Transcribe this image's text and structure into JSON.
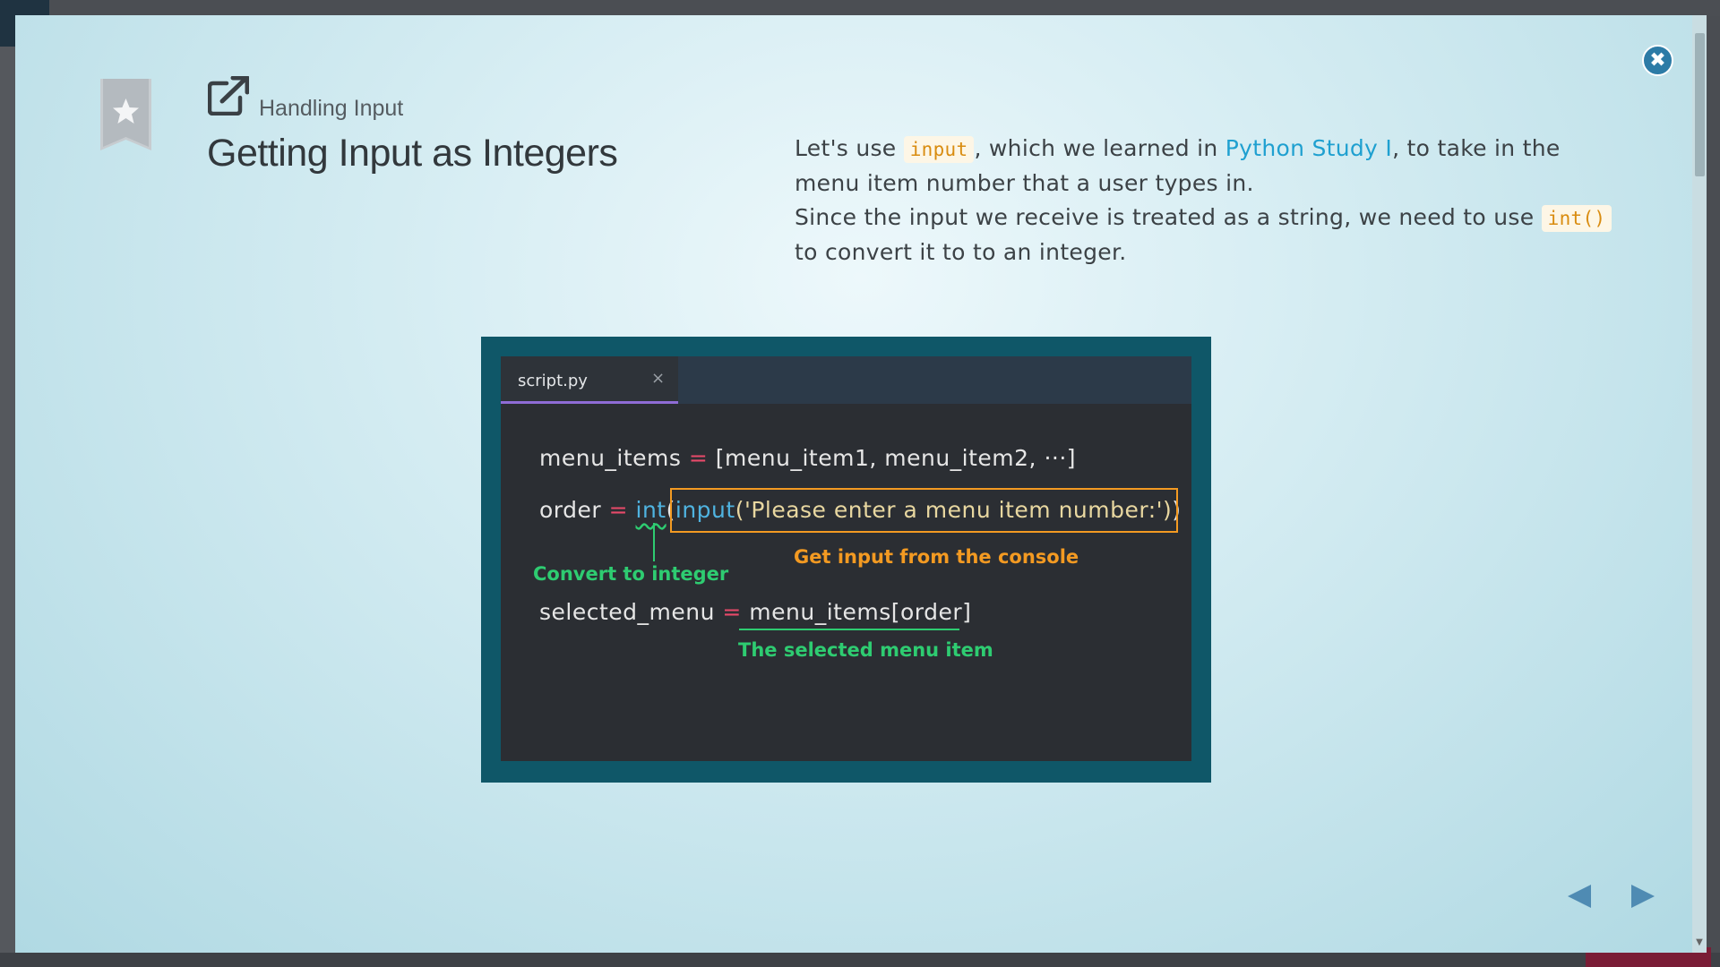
{
  "lesson": {
    "section": "Handling Input",
    "title": "Getting Input as Integers"
  },
  "description": {
    "p1_before": "Let's use ",
    "p1_code": "input",
    "p1_middle": ", which we learned in ",
    "p1_link": "Python Study I",
    "p1_after": ", to take in the menu item number that a user types in.",
    "p2_before": "Since the input we receive is treated as a string, we need to use ",
    "p2_code": "int()",
    "p2_after": " to convert it to to an integer."
  },
  "editor": {
    "tab_label": "script.py",
    "tab_close": "×",
    "line1": {
      "var": "menu_items",
      "op": " = ",
      "rest": "[menu_item1, menu_item2, ···]"
    },
    "line2": {
      "var": "order",
      "op": " = ",
      "fn1": "int",
      "paren": "(",
      "fn2": "input",
      "str": "('Please enter a menu item number:')",
      "close": ")"
    },
    "line3": {
      "var": "selected_menu",
      "op": " = ",
      "rest": "menu_items[order]"
    }
  },
  "annotations": {
    "convert": "Convert to integer",
    "console": "Get input from the console",
    "selected": "The selected menu item"
  },
  "icons": {
    "bookmark": "bookmark-star-icon",
    "external": "external-link-icon",
    "close": "close-icon",
    "prev": "prev-arrow-icon",
    "next": "next-arrow-icon"
  },
  "colors": {
    "accent_blue": "#2c7ba6",
    "code_chip": "#d98c10",
    "annotation_green": "#2ecc71",
    "annotation_orange": "#f39a22",
    "editor_frame": "#0f5768"
  }
}
